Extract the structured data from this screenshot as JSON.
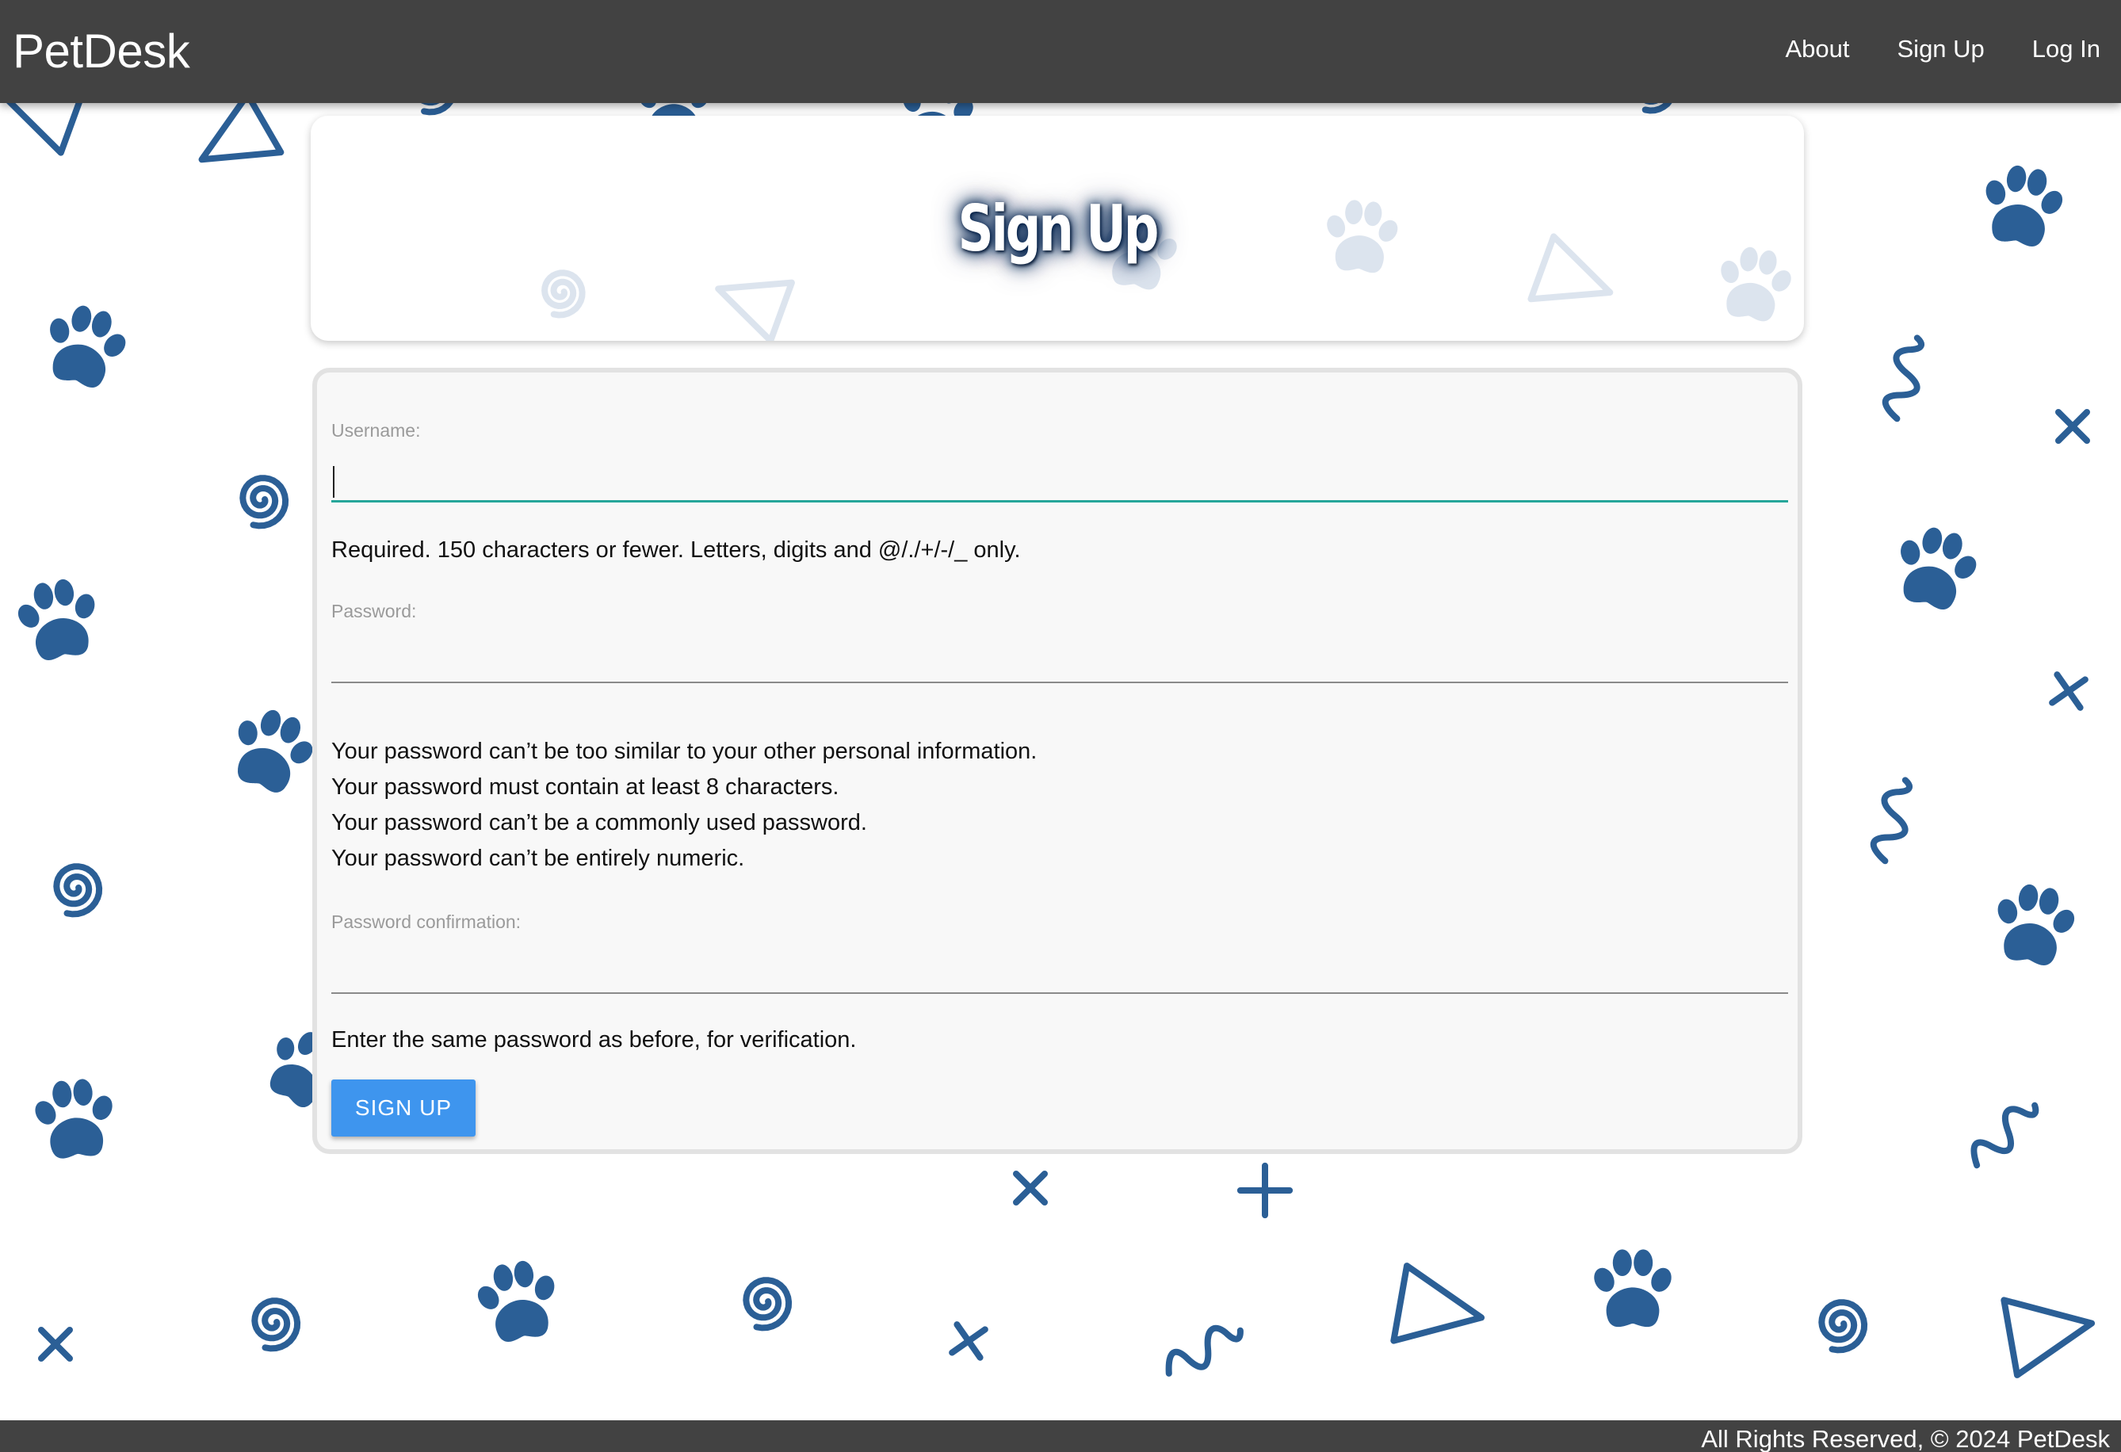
{
  "navbar": {
    "brand": "PetDesk",
    "links": [
      "About",
      "Sign Up",
      "Log In"
    ]
  },
  "header": {
    "title": "Sign Up"
  },
  "form": {
    "username_label": "Username:",
    "username_value": "",
    "username_help": "Required. 150 characters or fewer. Letters, digits and @/./+/-/_ only.",
    "password_label": "Password:",
    "password_value": "",
    "password_rules": [
      "Your password can’t be too similar to your other personal information.",
      "Your password must contain at least 8 characters.",
      "Your password can’t be a commonly used password.",
      "Your password can’t be entirely numeric."
    ],
    "confirm_label": "Password confirmation:",
    "confirm_value": "",
    "confirm_help": "Enter the same password as before, for verification.",
    "submit_label": "SIGN UP"
  },
  "footer": {
    "text": "All Rights Reserved, © 2024 PetDesk"
  },
  "colors": {
    "navbar": "#424242",
    "pattern": "#2b5f96",
    "pattern_faded": "#dce4ee",
    "button": "#3e95ee",
    "input_focus": "#26a69a"
  },
  "decorations": [
    "paw-icon",
    "spiral-icon",
    "triangle-icon",
    "cross-icon",
    "squiggle-icon"
  ]
}
